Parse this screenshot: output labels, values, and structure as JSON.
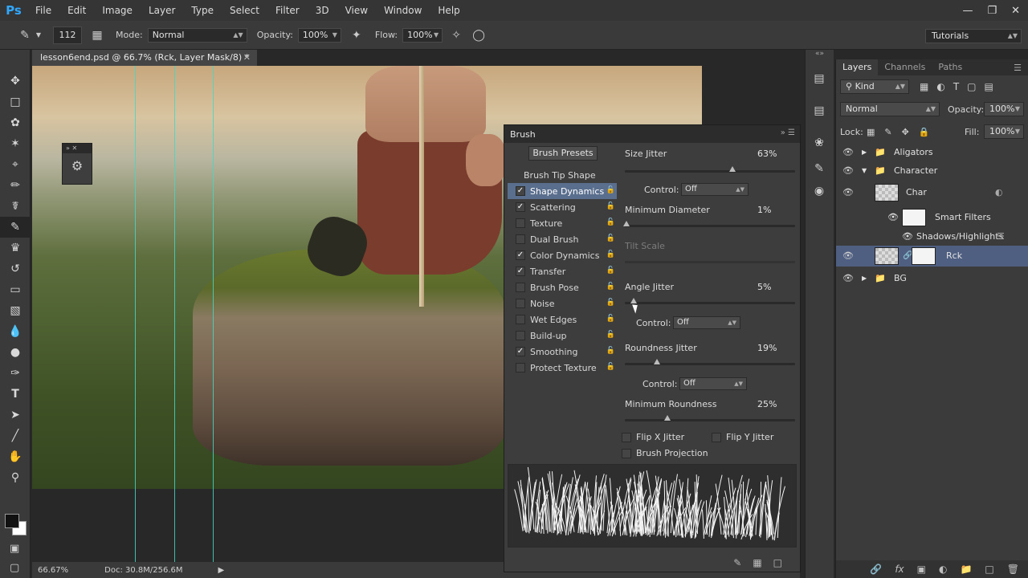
{
  "app": {
    "logo": "Ps",
    "menu": [
      "File",
      "Edit",
      "Image",
      "Layer",
      "Type",
      "Select",
      "Filter",
      "3D",
      "View",
      "Window",
      "Help"
    ],
    "window_controls": [
      "minimize-icon",
      "restore-icon",
      "close-icon"
    ]
  },
  "options_bar": {
    "brush_size": "112",
    "mode_label": "Mode:",
    "mode_value": "Normal",
    "opacity_label": "Opacity:",
    "opacity_value": "100%",
    "flow_label": "Flow:",
    "flow_value": "100%",
    "workspace": "Tutorials"
  },
  "document": {
    "tab_title": "lesson6end.psd @ 66.7% (Rck, Layer Mask/8) *",
    "zoom": "66.67%",
    "doc_size": "Doc: 30.8M/256.6M"
  },
  "brush_panel": {
    "title": "Brush",
    "presets_button": "Brush Presets",
    "tip_shape_label": "Brush Tip Shape",
    "options": [
      {
        "label": "Shape Dynamics",
        "checked": true,
        "selected": true
      },
      {
        "label": "Scattering",
        "checked": true,
        "selected": false
      },
      {
        "label": "Texture",
        "checked": false,
        "selected": false
      },
      {
        "label": "Dual Brush",
        "checked": false,
        "selected": false
      },
      {
        "label": "Color Dynamics",
        "checked": true,
        "selected": false
      },
      {
        "label": "Transfer",
        "checked": true,
        "selected": false
      },
      {
        "label": "Brush Pose",
        "checked": false,
        "selected": false
      },
      {
        "label": "Noise",
        "checked": false,
        "selected": false
      },
      {
        "label": "Wet Edges",
        "checked": false,
        "selected": false
      },
      {
        "label": "Build-up",
        "checked": false,
        "selected": false
      },
      {
        "label": "Smoothing",
        "checked": true,
        "selected": false
      },
      {
        "label": "Protect Texture",
        "checked": false,
        "selected": false
      }
    ],
    "size_jitter": {
      "label": "Size Jitter",
      "value": "63%",
      "fraction": 0.63
    },
    "size_control": {
      "label": "Control:",
      "value": "Off"
    },
    "min_diameter": {
      "label": "Minimum Diameter",
      "value": "1%",
      "fraction": 0.01
    },
    "tilt_scale": {
      "label": "Tilt Scale"
    },
    "angle_jitter": {
      "label": "Angle Jitter",
      "value": "5%",
      "fraction": 0.05
    },
    "angle_control": {
      "label": "Control:",
      "value": "Off"
    },
    "roundness_jitter": {
      "label": "Roundness Jitter",
      "value": "19%",
      "fraction": 0.19
    },
    "roundness_control": {
      "label": "Control:",
      "value": "Off"
    },
    "min_roundness": {
      "label": "Minimum Roundness",
      "value": "25%",
      "fraction": 0.25
    },
    "flip_x": "Flip X Jitter",
    "flip_y": "Flip Y Jitter",
    "brush_projection": "Brush Projection"
  },
  "layers_panel": {
    "tabs": [
      "Layers",
      "Channels",
      "Paths"
    ],
    "filter_kind": "Kind",
    "blend_mode": "Normal",
    "opacity_label": "Opacity:",
    "opacity_value": "100%",
    "lock_label": "Lock:",
    "fill_label": "Fill:",
    "fill_value": "100%",
    "layers": [
      {
        "name": "Aligators",
        "type": "group",
        "expanded": false
      },
      {
        "name": "Character",
        "type": "group",
        "expanded": true
      },
      {
        "name": "Char",
        "type": "smart-object"
      },
      {
        "name": "Smart Filters",
        "type": "filter-header"
      },
      {
        "name": "Shadows/Highlights",
        "type": "filter"
      },
      {
        "name": "Rck",
        "type": "layer-with-mask",
        "selected": true
      },
      {
        "name": "BG",
        "type": "group",
        "expanded": false
      }
    ]
  }
}
